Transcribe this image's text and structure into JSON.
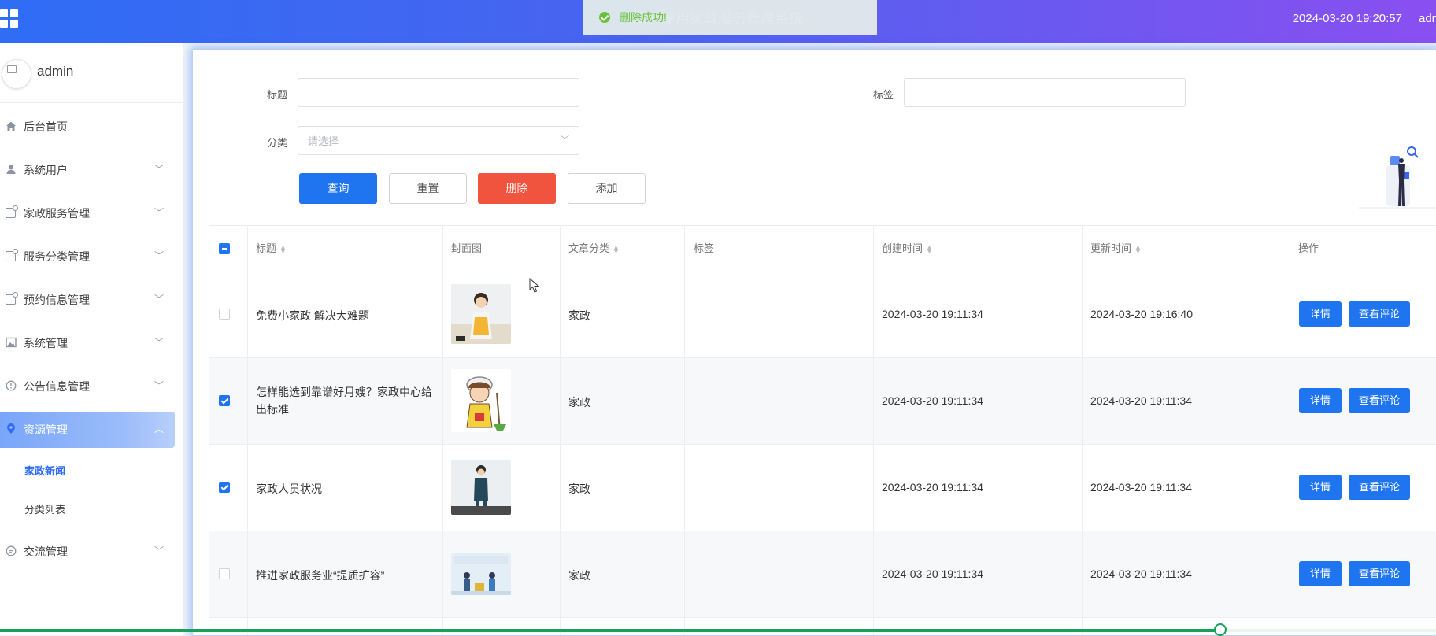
{
  "header": {
    "title": "欢迎使用家政服务管理系统",
    "datetime": "2024-03-20 19:20:57",
    "user": "admin"
  },
  "toast": {
    "message": "删除成功!"
  },
  "sidebar": {
    "username": "admin",
    "items": [
      {
        "label": "后台首页",
        "icon": "home-icon",
        "has_arrow": false
      },
      {
        "label": "系统用户",
        "icon": "user-icon",
        "has_arrow": true
      },
      {
        "label": "家政服务管理",
        "icon": "box-icon",
        "has_arrow": true
      },
      {
        "label": "服务分类管理",
        "icon": "box-icon",
        "has_arrow": true
      },
      {
        "label": "预约信息管理",
        "icon": "box-icon",
        "has_arrow": true
      },
      {
        "label": "系统管理",
        "icon": "picture-icon",
        "has_arrow": true
      },
      {
        "label": "公告信息管理",
        "icon": "info-icon",
        "has_arrow": true
      },
      {
        "label": "资源管理",
        "icon": "location-icon",
        "has_arrow": true,
        "expanded": true
      },
      {
        "label": "交流管理",
        "icon": "chat-icon",
        "has_arrow": true
      }
    ],
    "subitems": [
      {
        "label": "家政新闻",
        "current": true
      },
      {
        "label": "分类列表",
        "current": false
      }
    ]
  },
  "search": {
    "title_label": "标题",
    "tag_label": "标签",
    "category_label": "分类",
    "category_placeholder": "请选择"
  },
  "buttons": {
    "query": "查询",
    "reset": "重置",
    "delete": "删除",
    "add": "添加"
  },
  "table": {
    "headers": {
      "title": "标题",
      "cover": "封面图",
      "category": "文章分类",
      "tag": "标签",
      "created": "创建时间",
      "updated": "更新时间",
      "actions": "操作"
    },
    "rows": [
      {
        "title": "免费小家政 解决大难题",
        "category": "家政",
        "tag": "",
        "created": "2024-03-20 19:11:34",
        "updated": "2024-03-20 19:16:40",
        "checked": false,
        "detail": "详情",
        "comments": "查看评论"
      },
      {
        "title": "怎样能选到靠谱好月嫂？家政中心给出标准",
        "category": "家政",
        "tag": "",
        "created": "2024-03-20 19:11:34",
        "updated": "2024-03-20 19:11:34",
        "checked": true,
        "detail": "详情",
        "comments": "查看评论"
      },
      {
        "title": "家政人员状况",
        "category": "家政",
        "tag": "",
        "created": "2024-03-20 19:11:34",
        "updated": "2024-03-20 19:11:34",
        "checked": true,
        "detail": "详情",
        "comments": "查看评论"
      },
      {
        "title": "推进家政服务业“提质扩容”",
        "category": "家政",
        "tag": "",
        "created": "2024-03-20 19:11:34",
        "updated": "2024-03-20 19:11:34",
        "checked": false,
        "detail": "详情",
        "comments": "查看评论"
      }
    ]
  },
  "playback": {
    "progress": 0.85
  },
  "colors": {
    "primary": "#1f75ef",
    "danger": "#f0533e",
    "success": "#67c23a",
    "header_start": "#2f6df5",
    "header_end": "#8a4ff0"
  }
}
